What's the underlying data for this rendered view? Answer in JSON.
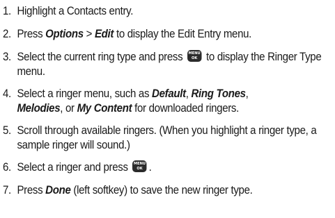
{
  "steps": [
    {
      "num": "1.",
      "parts": {
        "a": "Highlight a Contacts entry."
      }
    },
    {
      "num": "2.",
      "parts": {
        "a": "Press ",
        "b": "Options",
        "c": " > ",
        "d": "Edit",
        "e": " to display the Edit Entry menu."
      }
    },
    {
      "num": "3.",
      "parts": {
        "a": "Select the current ring type and press ",
        "b": " to display the Ringer Type menu."
      }
    },
    {
      "num": "4.",
      "parts": {
        "a": "Select a ringer menu, such as ",
        "b": "Default",
        "c": ", ",
        "d": "Ring Tones",
        "e": ",",
        "f": "Melodies",
        "g": ", or ",
        "h": "My Content",
        "i": " for downloaded ringers."
      }
    },
    {
      "num": "5.",
      "parts": {
        "a": "Scroll through available ringers. (When you highlight a ringer type, a sample ringer will sound.)"
      }
    },
    {
      "num": "6.",
      "parts": {
        "a": "Select a ringer and press ",
        "b": "."
      }
    },
    {
      "num": "7.",
      "parts": {
        "a": "Press ",
        "b": "Done",
        "c": " (left softkey) to save the new ringer type."
      }
    }
  ],
  "menu_key": {
    "top": "MENU",
    "bottom": "OK",
    "icon": "menu-ok-key-icon"
  }
}
